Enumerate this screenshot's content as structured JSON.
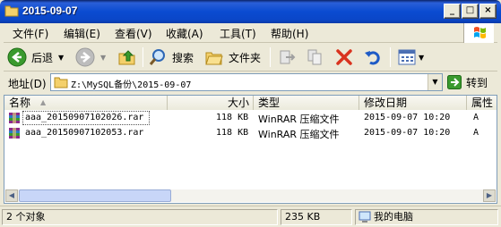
{
  "window": {
    "title": "2015-09-07",
    "controls": {
      "minimize": "_",
      "maximize": "□",
      "close": "×"
    }
  },
  "menu": {
    "items": [
      "文件(F)",
      "编辑(E)",
      "查看(V)",
      "收藏(A)",
      "工具(T)",
      "帮助(H)"
    ]
  },
  "toolbar": {
    "back_label": "后退",
    "search_label": "搜索",
    "folders_label": "文件夹"
  },
  "address": {
    "label": "地址(D)",
    "value": "Z:\\MySQL备份\\2015-09-07",
    "go_label": "转到"
  },
  "list": {
    "columns": [
      "名称",
      "大小",
      "类型",
      "修改日期",
      "属性"
    ],
    "rows": [
      {
        "name": "aaa_20150907102026.rar",
        "size": "118 KB",
        "type": "WinRAR 压缩文件",
        "modified": "2015-09-07 10:20",
        "attr": "A"
      },
      {
        "name": "aaa_20150907102053.rar",
        "size": "118 KB",
        "type": "WinRAR 压缩文件",
        "modified": "2015-09-07 10:20",
        "attr": "A"
      }
    ]
  },
  "status": {
    "count": "2 个对象",
    "total_size": "235 KB",
    "location": "我的电脑"
  },
  "colors": {
    "titlebar": "#0a4bd1",
    "close_button": "#c45a3b",
    "address_border": "#7f9db9"
  }
}
